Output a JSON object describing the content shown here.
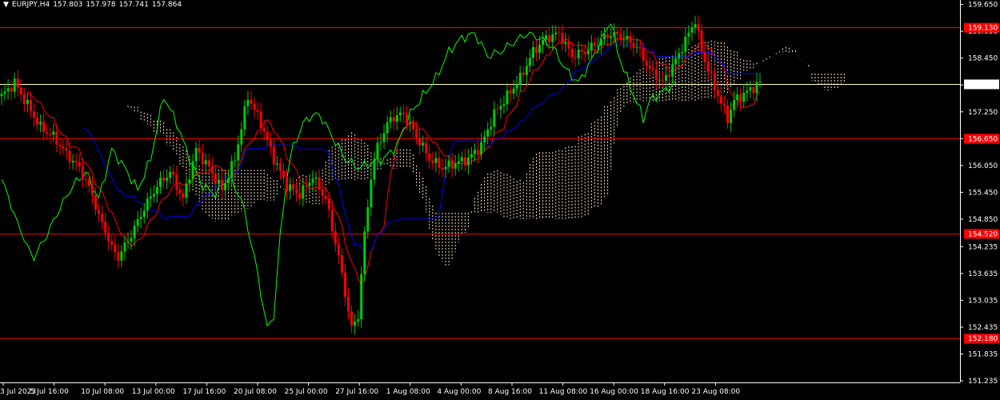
{
  "header": {
    "symbol_label": "EURJPY,H4",
    "ohlc": [
      "157.803",
      "157.978",
      "157.741",
      "157.864"
    ]
  },
  "colors": {
    "background": "#000000",
    "grid_frame": "#ffffff",
    "bull": "#00cc00",
    "bear": "#ff0000",
    "tenkan": "#ff0000",
    "kijun": "#0000ff",
    "chikou": "#00ff00",
    "kumo": "#ffe4c4",
    "level_line": "#ff0000",
    "current_line": "#ffffbb",
    "current_tag": "#ffffff"
  },
  "chart_data": {
    "type": "candlestick",
    "symbol": "EURJPY",
    "timeframe": "H4",
    "ylim": [
      151.2,
      159.75
    ],
    "y_ticks": [
      "159.650",
      "159.050",
      "158.450",
      "157.850",
      "157.250",
      "156.650",
      "156.050",
      "155.450",
      "154.850",
      "154.235",
      "153.635",
      "153.035",
      "152.435",
      "151.835",
      "151.235"
    ],
    "x_ticks": [
      "3 Jul 2023",
      "5 Jul 16:00",
      "10 Jul 08:00",
      "13 Jul 00:00",
      "17 Jul 16:00",
      "20 Jul 08:00",
      "25 Jul 00:00",
      "27 Jul 16:00",
      "1 Aug 08:00",
      "4 Aug 00:00",
      "8 Aug 16:00",
      "11 Aug 08:00",
      "16 Aug 00:00",
      "18 Aug 16:00",
      "23 Aug 08:00"
    ],
    "horizontal_levels": [
      {
        "value": 159.13,
        "label": "159.130"
      },
      {
        "value": 156.65,
        "label": "156.650"
      },
      {
        "value": 154.52,
        "label": "154.520"
      },
      {
        "value": 152.18,
        "label": "152.180"
      }
    ],
    "current_price": {
      "value": 157.864,
      "label": "157.864"
    },
    "anchors": [
      [
        0,
        157.6
      ],
      [
        4,
        157.9
      ],
      [
        8,
        157.4
      ],
      [
        12,
        156.9
      ],
      [
        16,
        156.7
      ],
      [
        20,
        156.3
      ],
      [
        24,
        156.0
      ],
      [
        28,
        155.4
      ],
      [
        30,
        154.9
      ],
      [
        32,
        154.6
      ],
      [
        34,
        154.2
      ],
      [
        36,
        154.0
      ],
      [
        40,
        154.5
      ],
      [
        44,
        155.1
      ],
      [
        48,
        155.6
      ],
      [
        52,
        155.9
      ],
      [
        56,
        155.3
      ],
      [
        60,
        156.4
      ],
      [
        64,
        156.0
      ],
      [
        68,
        155.5
      ],
      [
        72,
        156.2
      ],
      [
        76,
        157.6
      ],
      [
        80,
        157.0
      ],
      [
        84,
        156.2
      ],
      [
        88,
        155.6
      ],
      [
        92,
        155.4
      ],
      [
        96,
        155.8
      ],
      [
        100,
        155.3
      ],
      [
        104,
        154.0
      ],
      [
        106,
        153.2
      ],
      [
        108,
        152.4
      ],
      [
        110,
        152.7
      ],
      [
        112,
        154.5
      ],
      [
        114,
        155.8
      ],
      [
        116,
        156.5
      ],
      [
        120,
        157.1
      ],
      [
        124,
        157.2
      ],
      [
        128,
        156.7
      ],
      [
        132,
        156.2
      ],
      [
        136,
        156.0
      ],
      [
        140,
        156.1
      ],
      [
        144,
        156.2
      ],
      [
        148,
        156.5
      ],
      [
        152,
        157.2
      ],
      [
        156,
        157.6
      ],
      [
        160,
        158.0
      ],
      [
        164,
        158.6
      ],
      [
        168,
        158.9
      ],
      [
        172,
        159.0
      ],
      [
        176,
        158.5
      ],
      [
        180,
        158.6
      ],
      [
        184,
        158.8
      ],
      [
        188,
        159.0
      ],
      [
        192,
        158.9
      ],
      [
        196,
        158.7
      ],
      [
        200,
        158.2
      ],
      [
        204,
        157.9
      ],
      [
        208,
        158.4
      ],
      [
        212,
        159.0
      ],
      [
        214,
        159.3
      ],
      [
        216,
        158.6
      ],
      [
        220,
        157.8
      ],
      [
        224,
        157.1
      ],
      [
        226,
        157.5
      ],
      [
        230,
        157.7
      ],
      [
        234,
        157.9
      ]
    ]
  }
}
